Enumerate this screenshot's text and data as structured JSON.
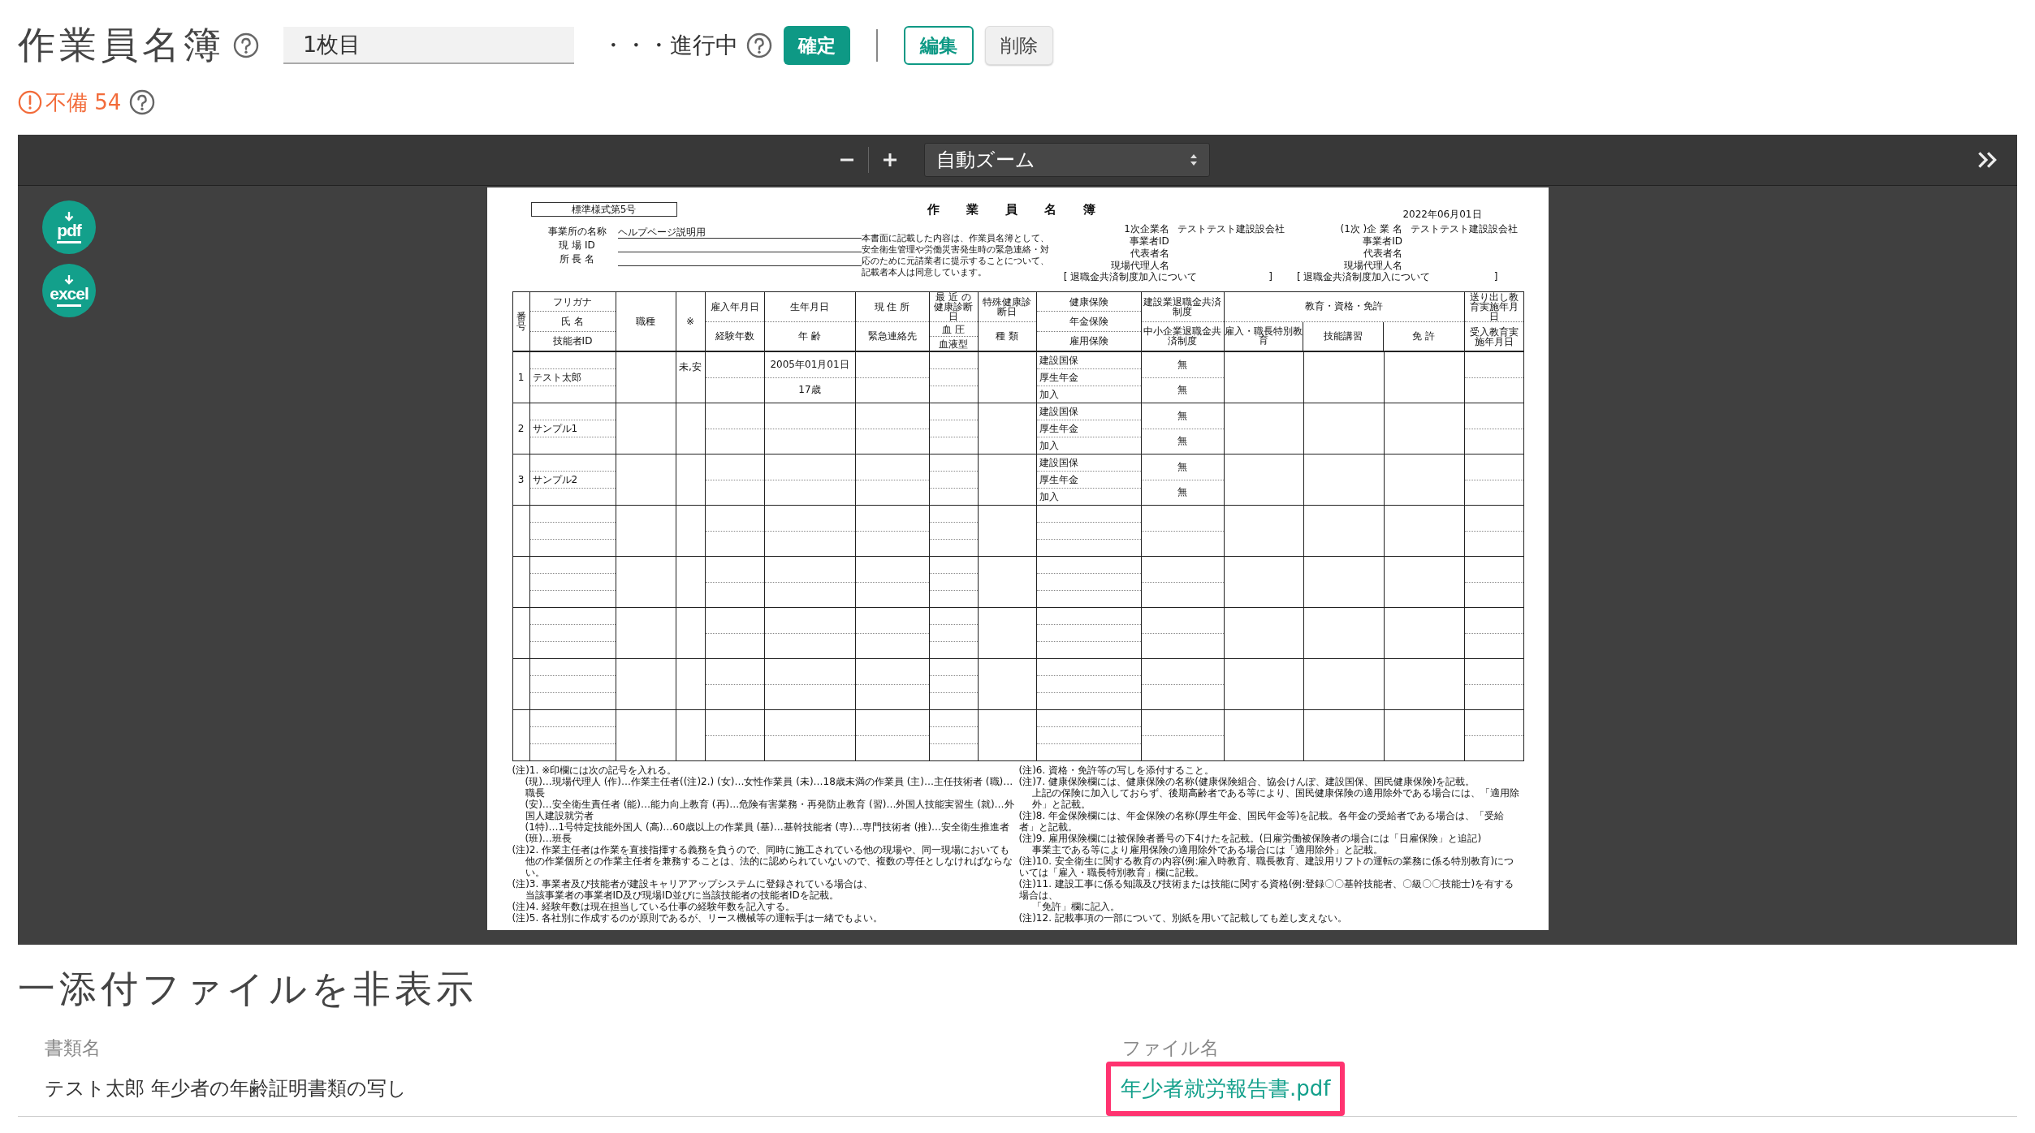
{
  "header": {
    "title": "作業員名簿",
    "sheet_field": {
      "value": "1枚目"
    },
    "status": "・・・進行中",
    "confirm_button": "確定",
    "edit_button": "編集",
    "delete_button": "削除"
  },
  "deficiency": {
    "label": "不備 54"
  },
  "viewer": {
    "zoom_select": "自動ズーム",
    "download_buttons": [
      "pdf",
      "excel"
    ],
    "document": {
      "form_label": "標準様式第5号",
      "title": "作 業 員 名 簿",
      "date": "2022年06月01日",
      "site_info": [
        {
          "label": "事業所の名称",
          "value": "ヘルプページ説明用"
        },
        {
          "label": "現 場 ID"
        },
        {
          "label": "所 長 名"
        }
      ],
      "consent_notice": "本書面に記載した内容は、作業員名簿として、安全衛生管理や労働災害発生時の緊急連絡・対応のために元請業者に提示することについて、記載者本人は同意しています。",
      "contractors": [
        {
          "rows": [
            {
              "label": "1次企業名",
              "value": "テストテスト建設設会社"
            },
            {
              "label": "事業者ID"
            },
            {
              "label": "代表者名"
            },
            {
              "label": "現場代理人名"
            }
          ],
          "retirement_open": "[ 退職金共済制度加入について",
          "retirement_close": "]"
        },
        {
          "rows": [
            {
              "label": "(1次 )企 業 名",
              "value": "テストテスト建設設会社"
            },
            {
              "label": "事業者ID"
            },
            {
              "label": "代表者名"
            },
            {
              "label": "現場代理人名"
            }
          ],
          "retirement_open": "[ 退職金共済制度加入について",
          "retirement_close": "]"
        }
      ],
      "columns": [
        {
          "labels": [
            "番号"
          ]
        },
        {
          "labels": [
            "フリガナ",
            "氏 名",
            "技能者ID"
          ]
        },
        {
          "labels": [
            "職種"
          ]
        },
        {
          "labels": [
            "※"
          ]
        },
        {
          "labels": [
            "雇入年月日",
            "経験年数"
          ]
        },
        {
          "labels": [
            "生年月日",
            "年 齢"
          ]
        },
        {
          "labels": [
            "現 住 所",
            "緊急連絡先"
          ]
        },
        {
          "labels": [
            "最 近 の健康診断日",
            "血 圧",
            "血液型"
          ]
        },
        {
          "labels": [
            "特殊健康診断日",
            "種 類"
          ]
        },
        {
          "labels": [
            "健康保険",
            "年金保険",
            "雇用保険"
          ]
        },
        {
          "labels": [
            "建設業退職金共済制度",
            "中小企業退職金共済制度"
          ]
        },
        {
          "group": "教育・資格・免許",
          "labels": [
            "雇入・職長特別教育",
            "技能講習",
            "免 許"
          ]
        },
        {
          "labels": [
            "送り出し教育実施年月日",
            "受入教育実施年月日"
          ]
        }
      ],
      "rows": [
        {
          "number": "1",
          "name": "テスト太郎",
          "mark": "未,安",
          "birth_date": "2005年01月01日",
          "age": "17歳",
          "health_insurance": "建設国保",
          "pension": "厚生年金",
          "employment_insurance": "加入",
          "retirement_kensetsu": "無",
          "retirement_chusho": "無"
        },
        {
          "number": "2",
          "name": "サンプル1",
          "health_insurance": "建設国保",
          "pension": "厚生年金",
          "employment_insurance": "加入",
          "retirement_kensetsu": "無",
          "retirement_chusho": "無"
        },
        {
          "number": "3",
          "name": "サンプル2",
          "health_insurance": "建設国保",
          "pension": "厚生年金",
          "employment_insurance": "加入",
          "retirement_kensetsu": "無",
          "retirement_chusho": "無"
        }
      ],
      "notes_left": [
        {
          "lines": [
            "(注)1. ※印欄には次の記号を入れる。",
            "(現)…現場代理人 (作)…作業主任者((注)2.) (女)…女性作業員 (未)…18歳未満の作業員 (主)…主任技術者 (職)…職長",
            "(安)…安全衛生責任者 (能)…能力向上教育 (再)…危険有害業務・再発防止教育 (習)…外国人技能実習生 (就)…外国人建設就労者",
            "(1特)…1号特定技能外国人 (高)…60歳以上の作業員 (基)…基幹技能者 (専)…専門技術者 (推)…安全衛生推進者 (班)…班長"
          ]
        },
        {
          "lines": [
            "(注)2. 作業主任者は作業を直接指揮する義務を負うので、同時に施工されている他の現場や、同一現場においても",
            "他の作業個所との作業主任者を兼務することは、法的に認められていないので、複数の専任としなければならない。"
          ]
        },
        {
          "lines": [
            "(注)3. 事業者及び技能者が建設キャリアアップシステムに登録されている場合は、",
            "当該事業者の事業者ID及び現場ID並びに当該技能者の技能者IDを記載。"
          ]
        },
        {
          "lines": [
            "(注)4. 経験年数は現在担当している仕事の経験年数を記入する。"
          ]
        },
        {
          "lines": [
            "(注)5. 各社別に作成するのが原則であるが、リース機械等の運転手は一緒でもよい。"
          ]
        }
      ],
      "notes_right": [
        {
          "lines": [
            "(注)6. 資格・免許等の写しを添付すること。"
          ]
        },
        {
          "lines": [
            "(注)7. 健康保険欄には、健康保険の名称(健康保険組合、協会けんぽ、建設国保、国民健康保険)を記載。",
            "上記の保険に加入しておらず、後期高齢者である等により、国民健康保険の適用除外である場合には、「適用除外」と記載。"
          ]
        },
        {
          "lines": [
            "(注)8. 年金保険欄には、年金保険の名称(厚生年金、国民年金等)を記載。各年金の受給者である場合は、「受給者」と記載。"
          ]
        },
        {
          "lines": [
            "(注)9. 雇用保険欄には被保険者番号の下4けたを記載。(日雇労働被保険者の場合には「日雇保険」と追記)",
            "事業主である等により雇用保険の適用除外である場合には「適用除外」と記載。"
          ]
        },
        {
          "lines": [
            "(注)10. 安全衛生に関する教育の内容(例:雇入時教育、職長教育、建設用リフトの運転の業務に係る特別教育)については「雇入・職長特別教育」欄に記載。"
          ]
        },
        {
          "lines": [
            "(注)11. 建設工事に係る知識及び技術または技能に関する資格(例:登録〇〇基幹技能者、〇級〇〇技能士)を有する場合は、",
            "「免許」欄に記入。"
          ]
        },
        {
          "lines": [
            "(注)12. 記載事項の一部について、別紙を用いて記載しても差し支えない。"
          ]
        }
      ]
    }
  },
  "attachments": {
    "toggle": "一添付ファイルを非表示",
    "columns": [
      "書類名",
      "ファイル名"
    ],
    "rows": [
      {
        "document_name": "テスト太郎 年少者の年齢証明書類の写し",
        "file_name": "年少者就労報告書.pdf",
        "highlighted": true
      }
    ]
  }
}
